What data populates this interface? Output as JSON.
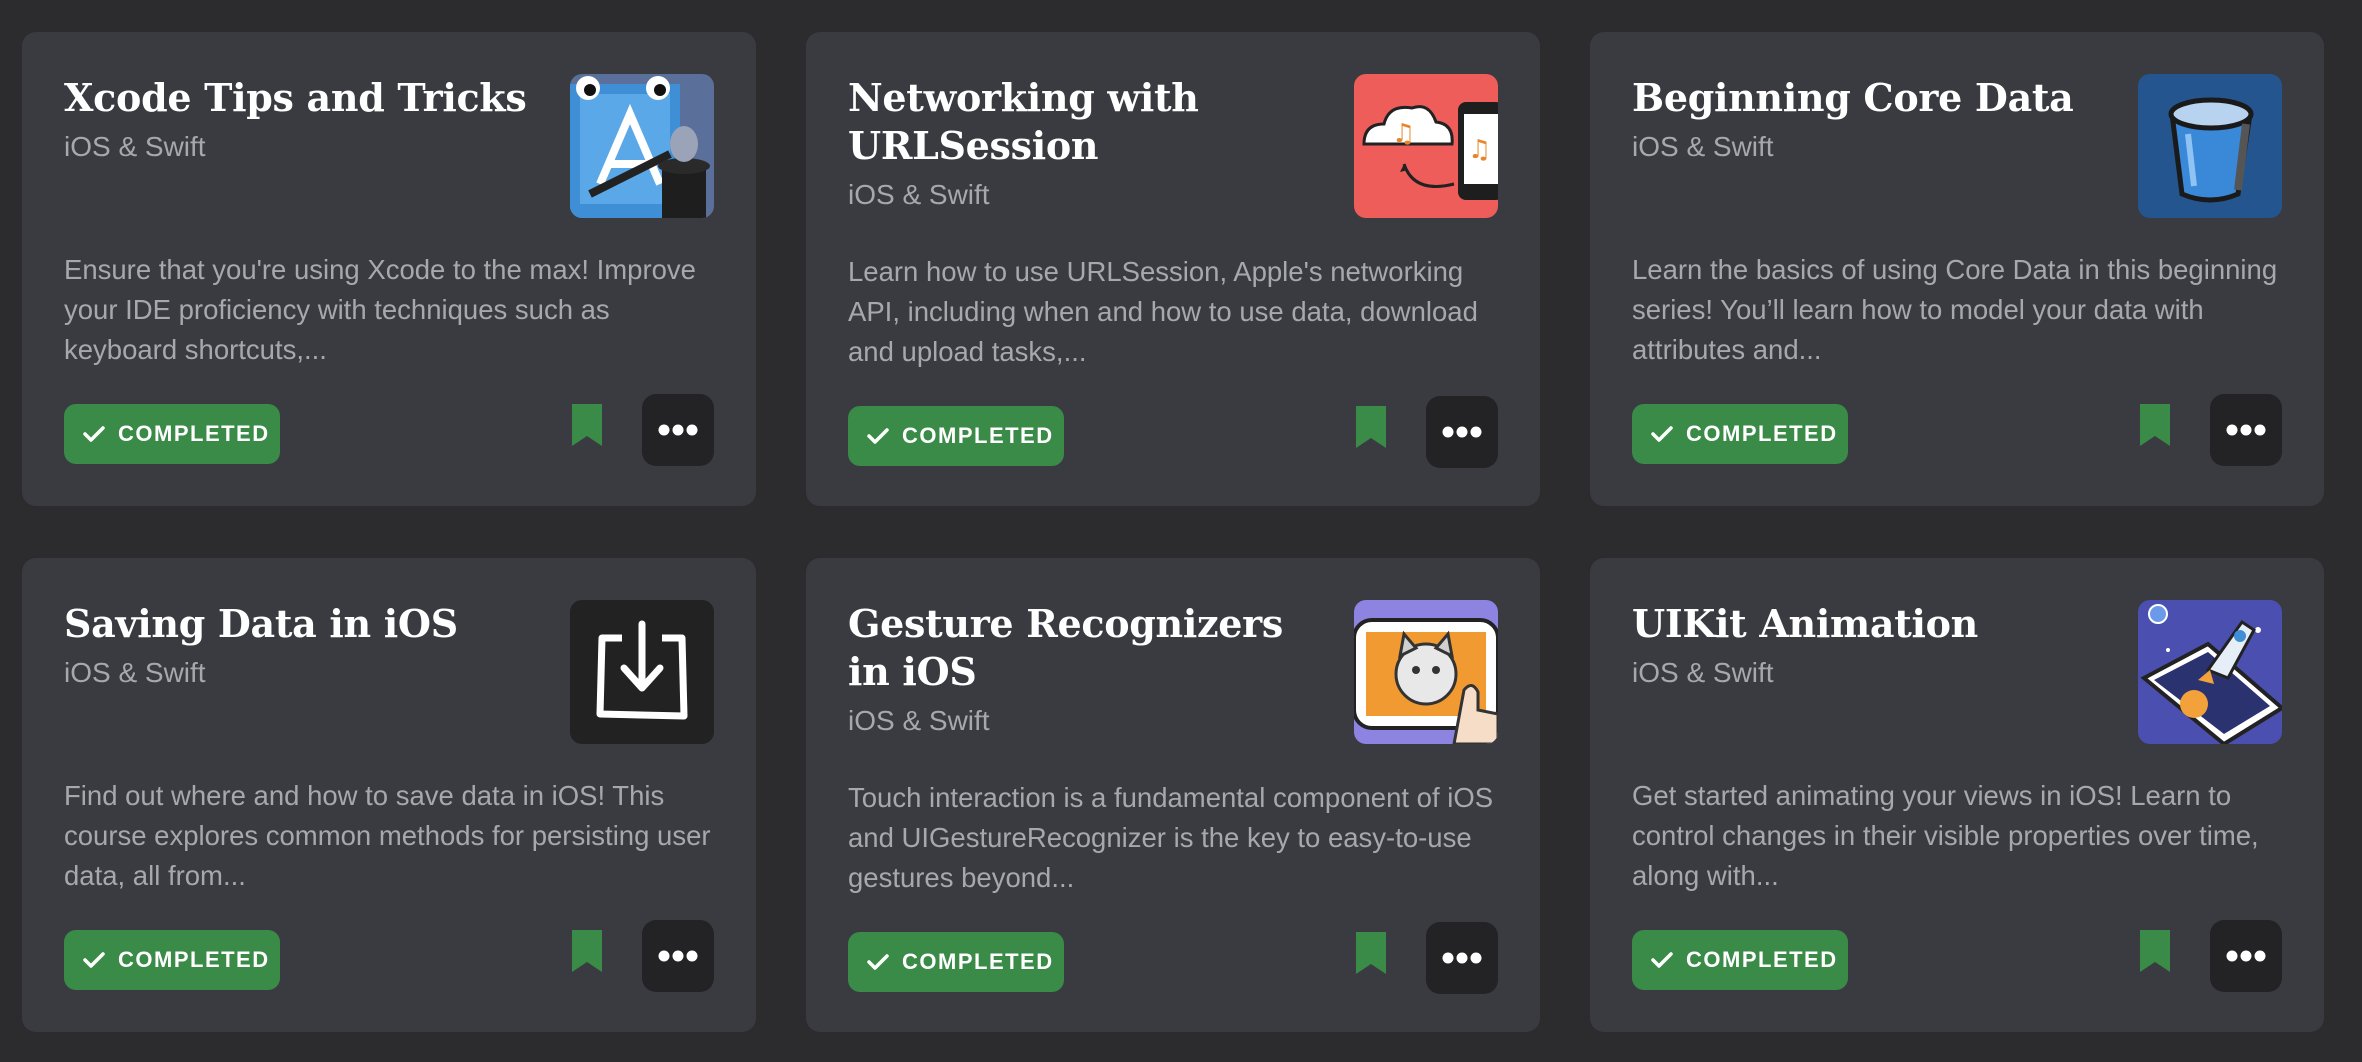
{
  "cards": [
    {
      "title": "Xcode Tips and Tricks",
      "category": "iOS & Swift",
      "description": "Ensure that you're using Xcode to the max! Improve your IDE proficiency with techniques such as keyboard shortcuts,...",
      "status": "COMPLETED",
      "thumbnail_icon": "xcode-magic-icon"
    },
    {
      "title": "Networking with URLSession",
      "category": "iOS & Swift",
      "description": "Learn how to use URLSession, Apple's networking API, including when and how to use data, download and upload tasks,...",
      "status": "COMPLETED",
      "thumbnail_icon": "cloud-music-phone-icon"
    },
    {
      "title": "Beginning Core Data",
      "category": "iOS & Swift",
      "description": "Learn the basics of using Core Data in this beginning series! You’ll learn how to model your data with attributes and...",
      "status": "COMPLETED",
      "thumbnail_icon": "database-bucket-icon"
    },
    {
      "title": "Saving Data in iOS",
      "category": "iOS & Swift",
      "description": "Find out where and how to save data in iOS! This course explores common methods for persisting user data, all from...",
      "status": "COMPLETED",
      "thumbnail_icon": "download-tray-icon"
    },
    {
      "title": "Gesture Recognizers in iOS",
      "category": "iOS & Swift",
      "description": "Touch interaction is a fundamental component of iOS and UIGestureRecognizer is the key to easy-to-use gestures beyond...",
      "status": "COMPLETED",
      "thumbnail_icon": "cat-tablet-gesture-icon"
    },
    {
      "title": "UIKit Animation",
      "category": "iOS & Swift",
      "description": "Get started animating your views in iOS! Learn to control changes in their visible properties over time, along with...",
      "status": "COMPLETED",
      "thumbnail_icon": "rocket-phone-icon"
    }
  ],
  "colors": {
    "background": "#2c2c2e",
    "card": "#3a3b40",
    "completed_badge": "#3a8a48",
    "bookmark": "#3a8a48",
    "more_button": "#232325"
  }
}
